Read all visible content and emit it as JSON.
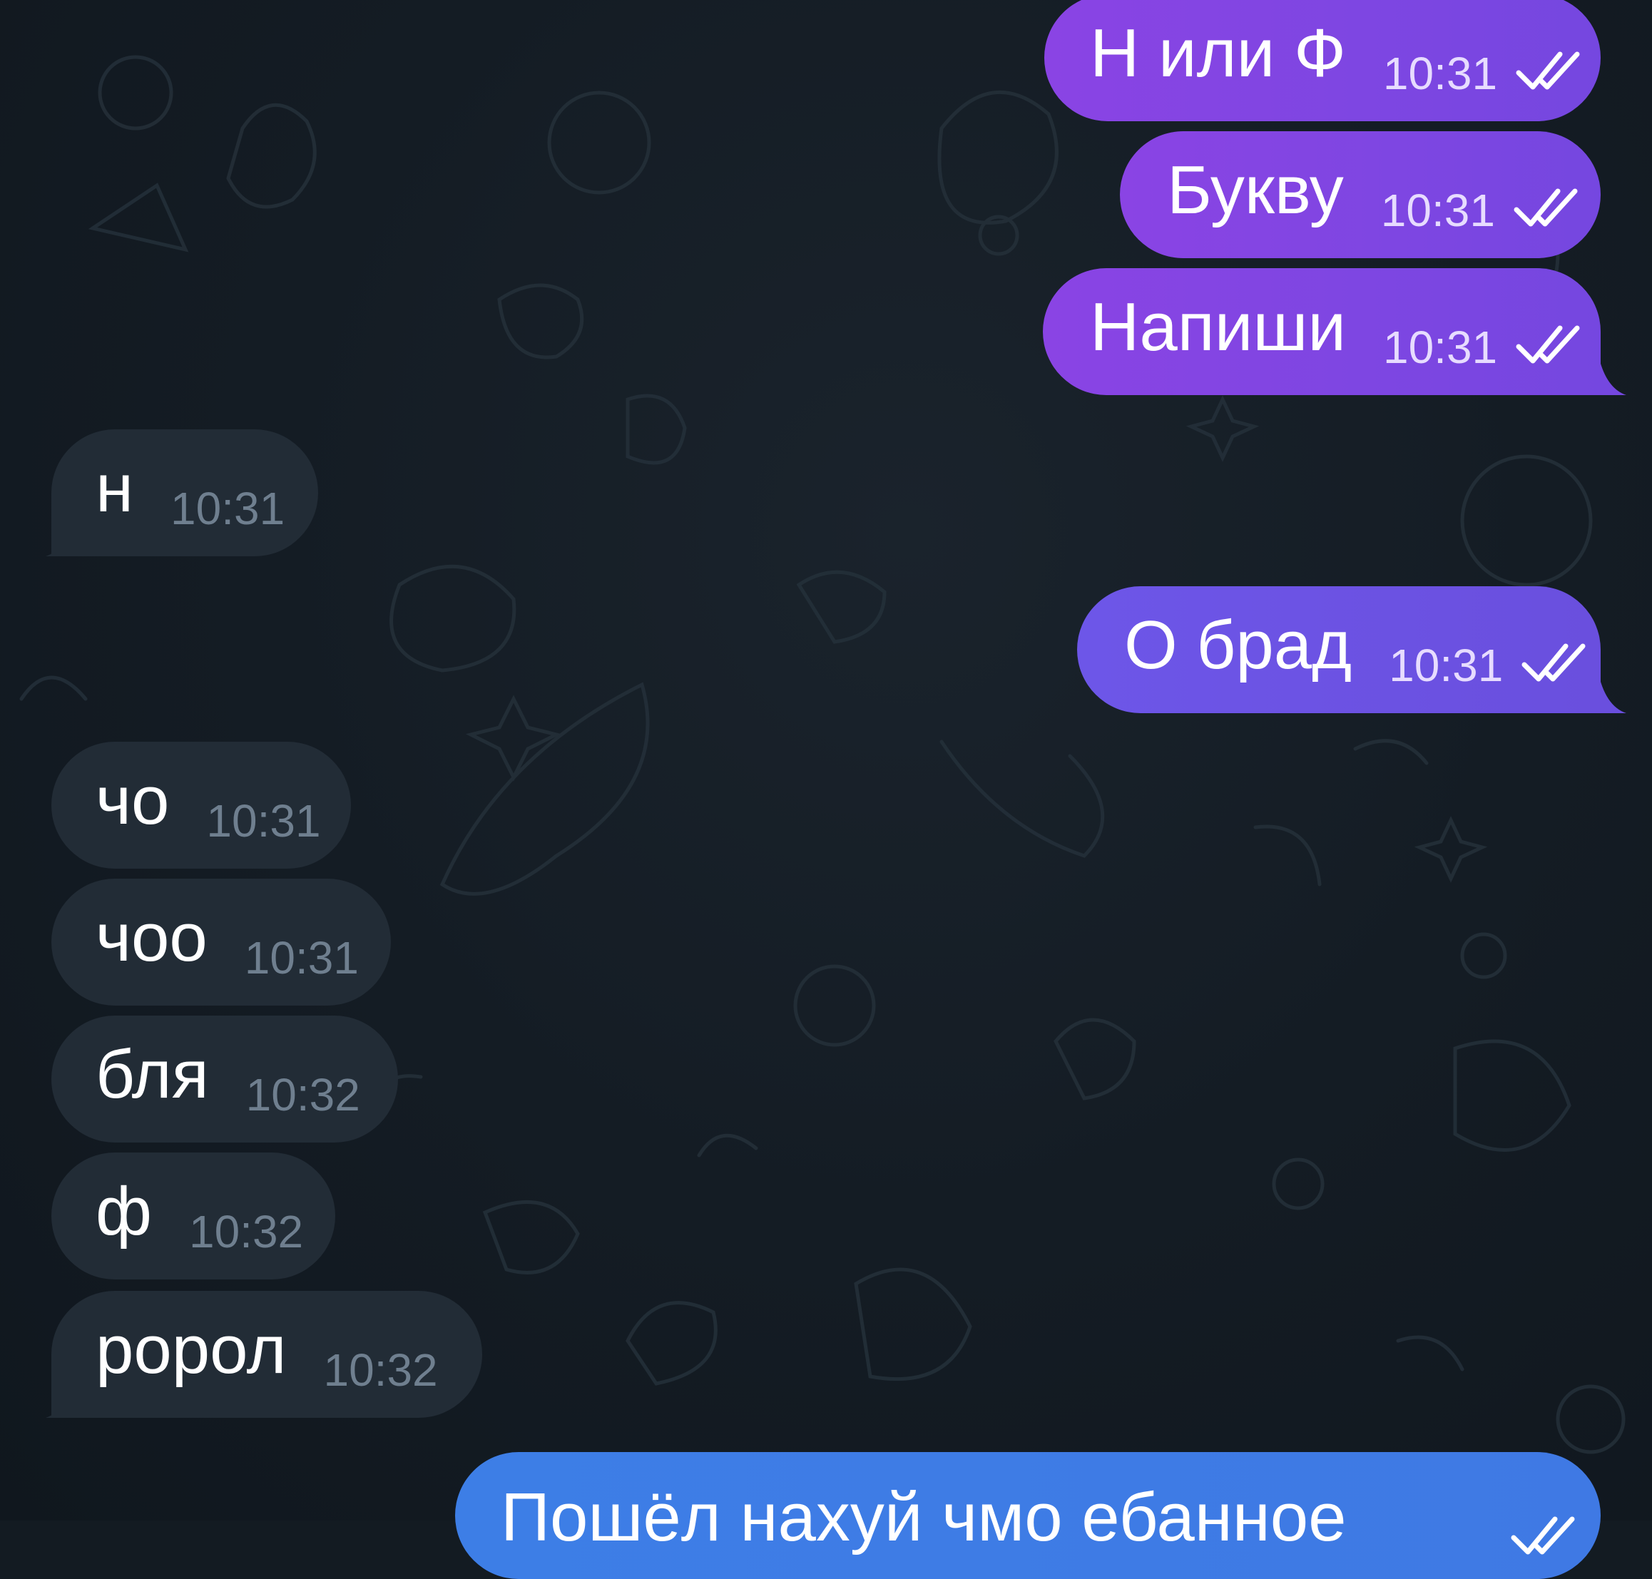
{
  "chat": {
    "messages": [
      {
        "direction": "out",
        "text": "Н или Ф",
        "time": "10:31",
        "status": "read"
      },
      {
        "direction": "out",
        "text": "Букву",
        "time": "10:31",
        "status": "read"
      },
      {
        "direction": "out",
        "text": "Напиши",
        "time": "10:31",
        "status": "read"
      },
      {
        "direction": "in",
        "text": "н",
        "time": "10:31"
      },
      {
        "direction": "out",
        "text": "О брад",
        "time": "10:31",
        "status": "read"
      },
      {
        "direction": "in",
        "text": "чо",
        "time": "10:31"
      },
      {
        "direction": "in",
        "text": "чоо",
        "time": "10:31"
      },
      {
        "direction": "in",
        "text": "бля",
        "time": "10:32"
      },
      {
        "direction": "in",
        "text": "ф",
        "time": "10:32"
      },
      {
        "direction": "in",
        "text": "ророл",
        "time": "10:32"
      },
      {
        "direction": "out",
        "text": "Пошёл нахуй чмо ебанное",
        "time": "",
        "status": "read"
      }
    ]
  },
  "colors": {
    "background": "#131b22",
    "outgoing_bubble": "#7f45e2",
    "outgoing_bubble_alt": "#6b52e4",
    "outgoing_bubble_last": "#3e7be5",
    "incoming_bubble": "#222c36",
    "incoming_time": "#6f7f8f",
    "text": "#ffffff"
  },
  "icons": {
    "read_status": "double-check-icon",
    "wallpaper": "doodle-pattern"
  }
}
